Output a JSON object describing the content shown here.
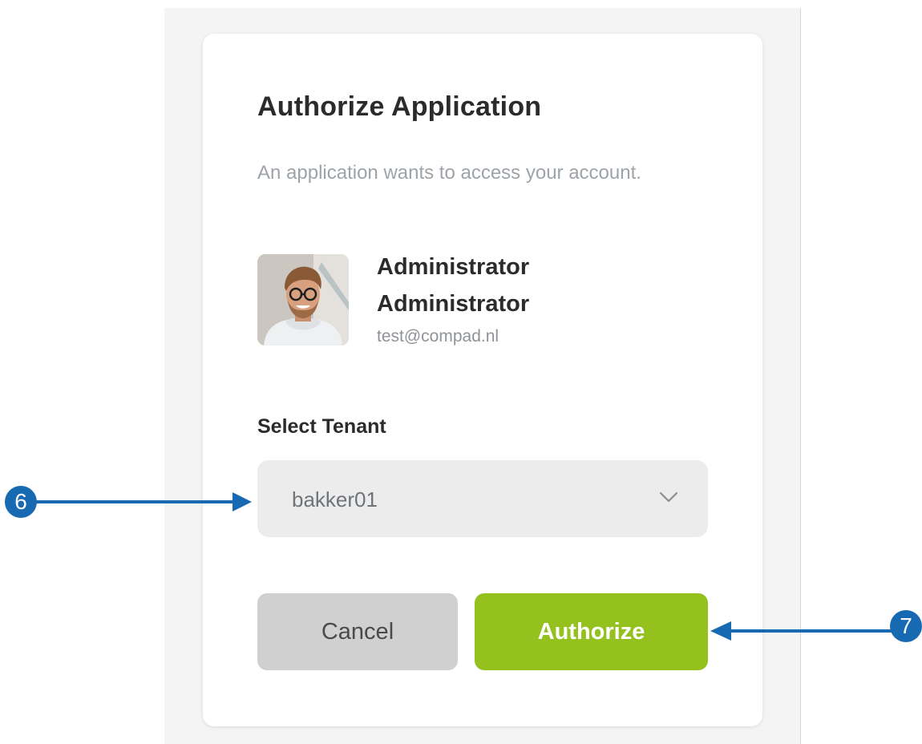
{
  "dialog": {
    "title": "Authorize Application",
    "subtitle": "An application wants to access your account."
  },
  "user": {
    "name": "Administrator Administrator",
    "email": "test@compad.nl",
    "avatar_icon": "user-photo"
  },
  "tenant": {
    "label": "Select Tenant",
    "selected": "bakker01"
  },
  "actions": {
    "cancel_label": "Cancel",
    "authorize_label": "Authorize",
    "authorize_color": "#95c11f"
  },
  "annotations": {
    "tenant_marker": "6",
    "authorize_marker": "7",
    "color": "#1769b2"
  }
}
